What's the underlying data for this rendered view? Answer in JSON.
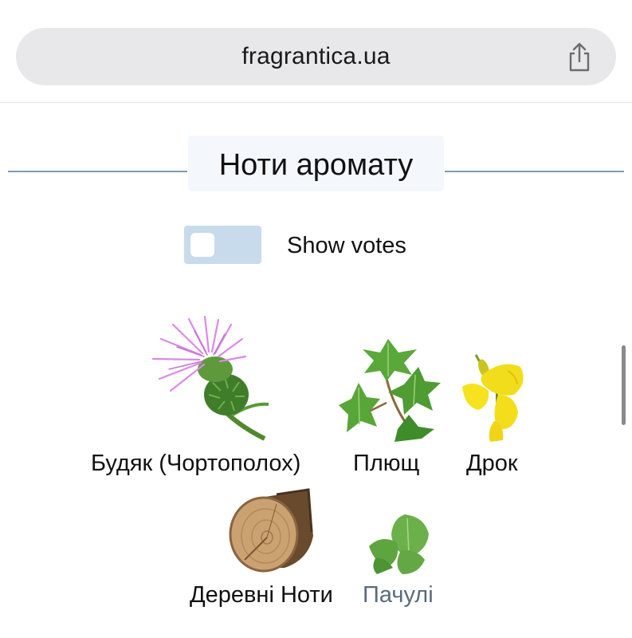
{
  "browser": {
    "url": "fragrantica.ua",
    "share_icon": "share-icon"
  },
  "section": {
    "title": "Ноти аромату"
  },
  "toggle": {
    "label": "Show votes",
    "on": false
  },
  "notes": [
    {
      "name": "Будяк (Чортополох)",
      "icon": "thistle-image"
    },
    {
      "name": "Плющ",
      "icon": "ivy-image"
    },
    {
      "name": "Дрок",
      "icon": "gorse-image"
    },
    {
      "name": "Деревні Ноти",
      "icon": "wood-log-image"
    },
    {
      "name": "Пачулі",
      "icon": "patchouli-image"
    }
  ],
  "colors": {
    "divider": "#7f97b4",
    "toggle_track": "#c8dbec",
    "title_bg": "#f4f7fb",
    "url_bar_bg": "#e8e8ea",
    "muted_label": "#5a6b7c"
  }
}
